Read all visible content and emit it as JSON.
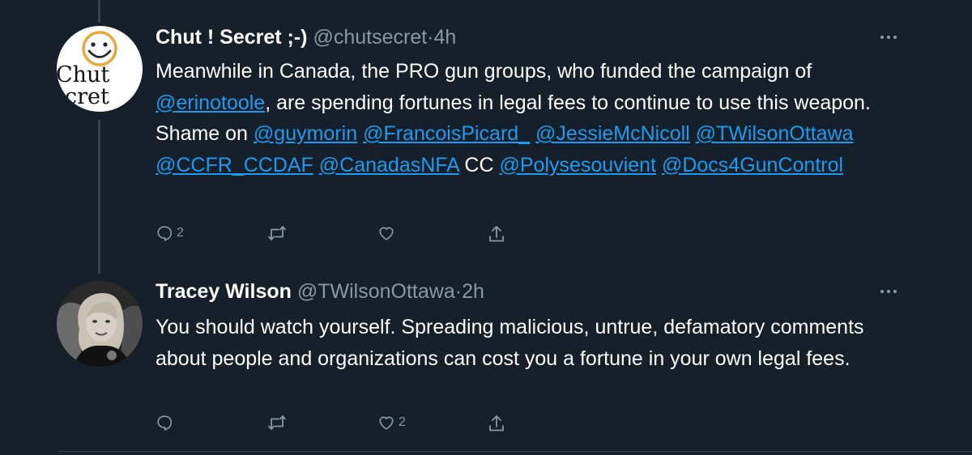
{
  "tweets": [
    {
      "author_name": "Chut ! Secret ;-)",
      "handle": "@chutsecret",
      "time": "4h",
      "avatar_text": [
        "Chut",
        "ecret"
      ],
      "body": [
        {
          "t": "Meanwhile in Canada, the PRO gun groups, who funded the campaign of "
        },
        {
          "t": "@erinotoole",
          "m": true
        },
        {
          "t": ", are spending fortunes in legal fees to continue to use this weapon.  Shame on "
        },
        {
          "t": "@guymorin",
          "m": true
        },
        {
          "t": " "
        },
        {
          "t": "@FrancoisPicard_",
          "m": true
        },
        {
          "t": " "
        },
        {
          "t": "@JessieMcNicoll",
          "m": true
        },
        {
          "t": " "
        },
        {
          "t": "@TWilsonOttawa",
          "m": true
        },
        {
          "t": " "
        },
        {
          "t": "@CCFR_CCDAF",
          "m": true
        },
        {
          "t": " "
        },
        {
          "t": "@CanadasNFA",
          "m": true
        },
        {
          "t": " CC "
        },
        {
          "t": "@Polysesouvient",
          "m": true
        },
        {
          "t": " "
        },
        {
          "t": "@Docs4GunControl",
          "m": true
        }
      ],
      "actions": {
        "reply_count": "2",
        "retweet_count": "",
        "like_count": ""
      }
    },
    {
      "author_name": "Tracey Wilson",
      "handle": "@TWilsonOttawa",
      "time": "2h",
      "body": [
        {
          "t": "You should watch yourself. Spreading malicious, untrue, defamatory comments about people and organizations can cost you a fortune in your own legal fees."
        }
      ],
      "actions": {
        "reply_count": "",
        "retweet_count": "",
        "like_count": "2"
      }
    }
  ],
  "separator": "·",
  "colors": {
    "background": "#15202b",
    "text": "#ffffff",
    "muted": "#8899a6",
    "link": "#1d9bf0",
    "line": "#38444d"
  },
  "icons": [
    "reply-icon",
    "retweet-icon",
    "like-icon",
    "share-icon",
    "more-icon"
  ]
}
